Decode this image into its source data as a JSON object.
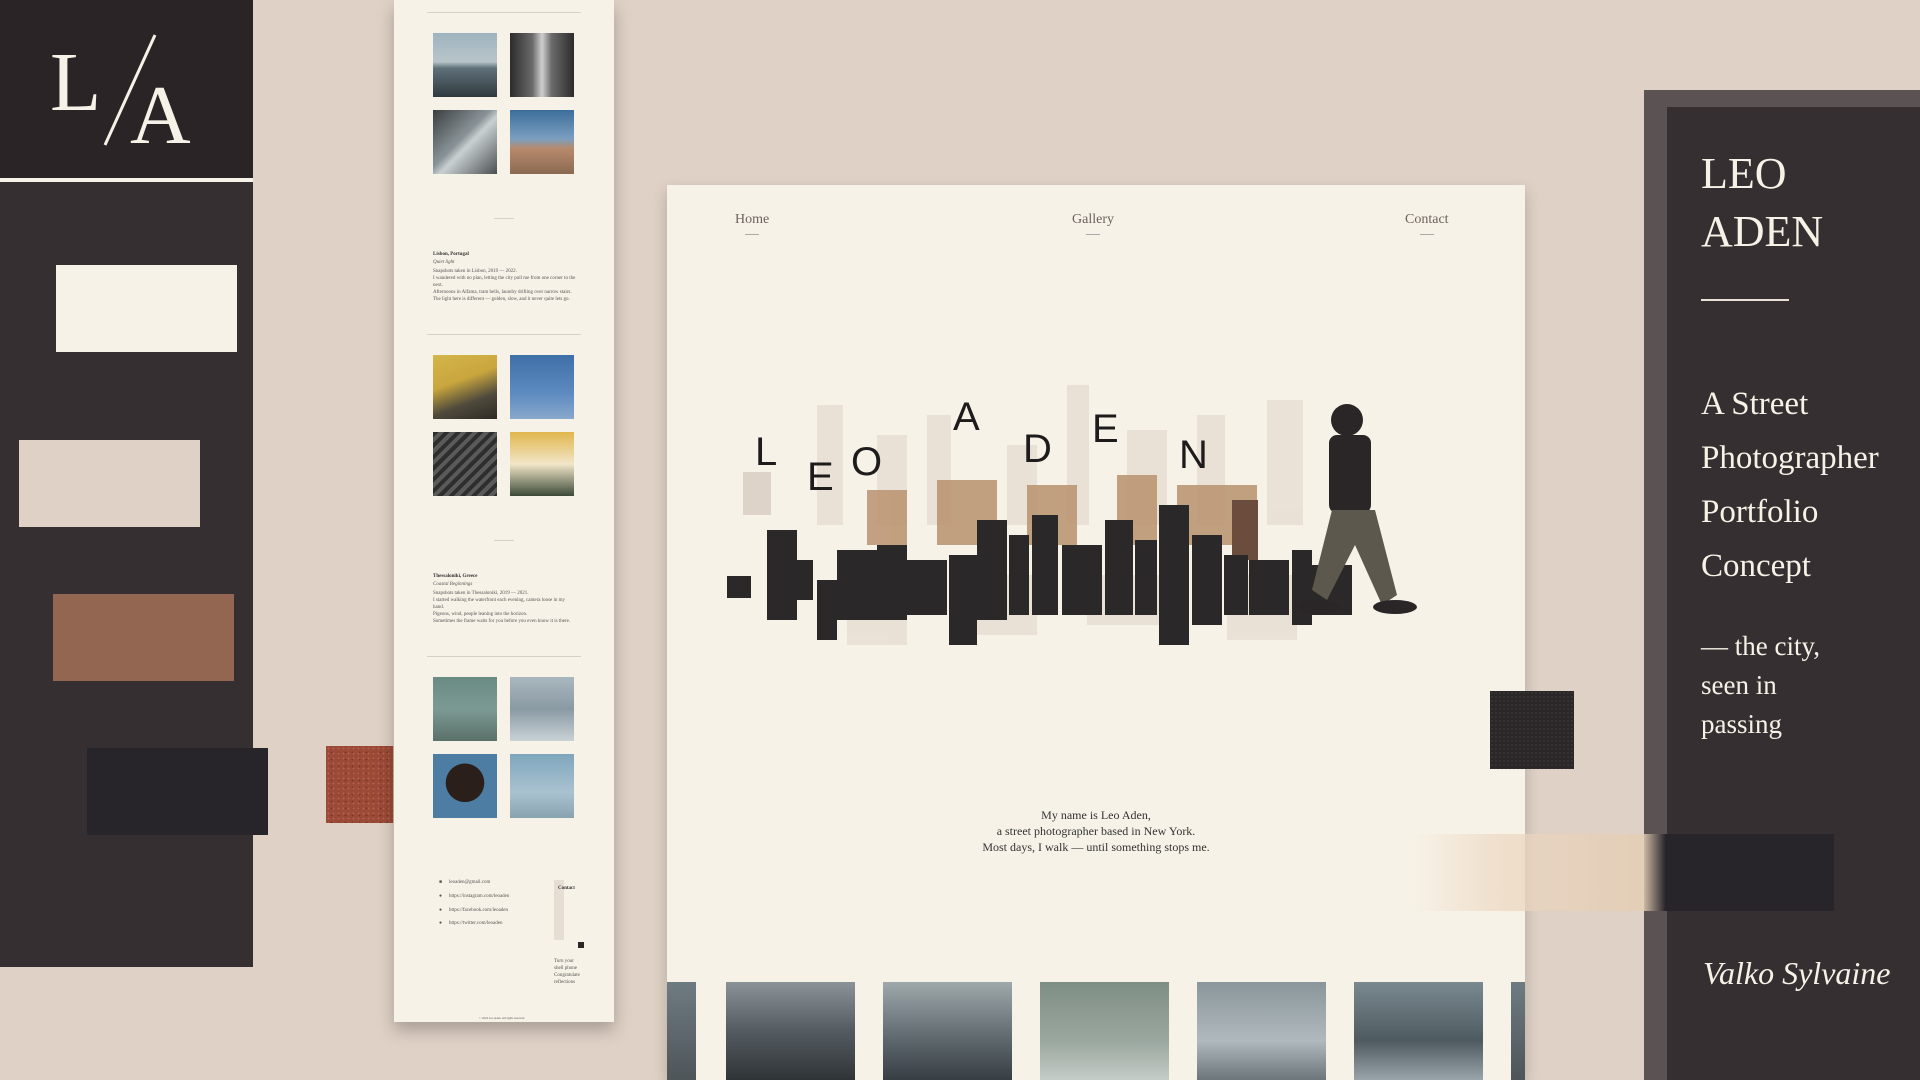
{
  "brand": {
    "logo_left": "L",
    "logo_right": "A"
  },
  "colors": {
    "cream": "#f7f2e7",
    "beige": "#dfd1c5",
    "brown": "#936651",
    "dark": "#28252a",
    "panel": "#362f31"
  },
  "longpage": {
    "section1": {
      "heading": "Lisbon, Portugal",
      "sub": "Quiet light",
      "lines": [
        "Snapshots taken in Lisbon, 2019 — 2022.",
        "I wandered with no plan, letting the city pull me from one corner to the next.",
        "Afternoons in Alfama, tram bells, laundry drifting over narrow stairs.",
        "The light here is different — golden, slow, and it never quite lets go."
      ]
    },
    "section2": {
      "heading": "Thessaloniki, Greece",
      "sub": "Coastal Beginnings",
      "lines": [
        "Snapshots taken in Thessaloniki, 2019 — 2021.",
        "I started walking the waterfront each evening, camera loose in my hand.",
        "Pigeons, wind, people leaning into the horizon.",
        "Sometimes the frame waits for you before you even know it is there."
      ]
    },
    "contact": {
      "title": "Contact",
      "items": [
        "leoaden@gmail.com",
        "https://instagram.com/leoaden",
        "https://facebook.com/leoaden",
        "https://twitter.com/leoaden"
      ],
      "note": "Turn your shell phone Congratulate reflections",
      "footer": "© 2024 Leo Aden. All rights reserved."
    }
  },
  "mockup": {
    "nav": {
      "home": "Home",
      "gallery": "Gallery",
      "contact": "Contact"
    },
    "hero_letters": [
      "L",
      "E",
      "O",
      "A",
      "D",
      "E",
      "N"
    ],
    "intro": {
      "line1": "My name is Leo Aden,",
      "line2": "a street photographer based in New York.",
      "line3": "Most days, I walk — until something stops me."
    }
  },
  "panel": {
    "name_line1": "LEO",
    "name_line2": "ADEN",
    "title_lines": [
      "A Street",
      "Photographer",
      "Portfolio",
      "Concept"
    ],
    "tag_lines": [
      "— the city,",
      "seen in",
      "passing"
    ],
    "signature": "Valko Sylvaine"
  }
}
